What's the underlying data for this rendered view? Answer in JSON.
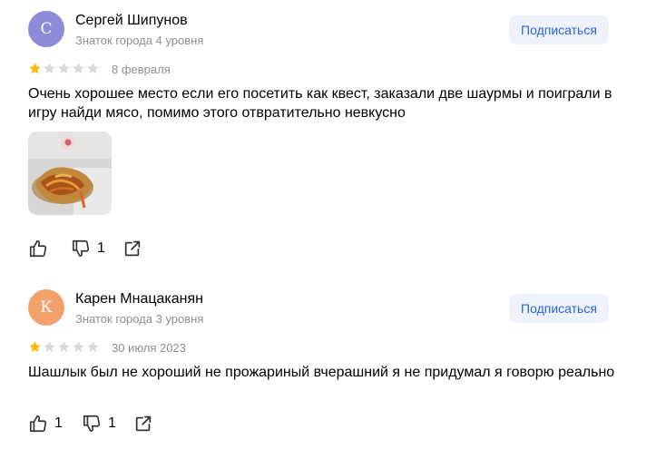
{
  "reviews": [
    {
      "avatar_letter": "С",
      "avatar_color": "#8e8cd8",
      "author": "Сергей Шипунов",
      "level": "Знаток города 4 уровня",
      "subscribe_label": "Подписаться",
      "rating": 1,
      "date": "8 февраля",
      "text": "Очень хорошее место если его посетить как квест, заказали две шаурмы и поиграли в игру найди мясо, помимо этого отвратительно невкусно",
      "has_photo": true,
      "likes": "",
      "dislikes": "1"
    },
    {
      "avatar_letter": "К",
      "avatar_color": "#f2a16b",
      "author": "Карен Мнацаканян",
      "level": "Знаток города 3 уровня",
      "subscribe_label": "Подписаться",
      "rating": 1,
      "date": "30 июля 2023",
      "text": "Шашлык был не хороший не прожариный вчерашний я не придумал я говорю реально",
      "has_photo": false,
      "likes": "1",
      "dislikes": "1"
    }
  ],
  "colors": {
    "star_filled": "#fcb900",
    "star_empty": "#d9d9d9",
    "accent": "#2b62dd"
  },
  "icons": {
    "like": "thumbs-up-icon",
    "dislike": "thumbs-down-icon",
    "share": "share-icon",
    "star": "star-icon"
  }
}
